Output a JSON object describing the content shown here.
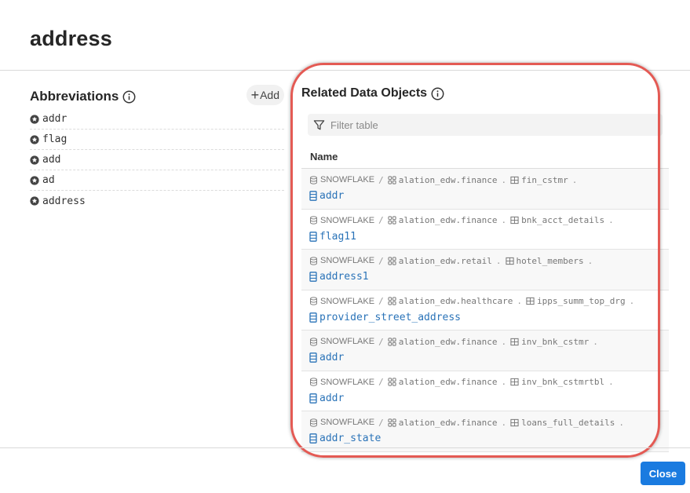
{
  "page": {
    "title": "address"
  },
  "abbreviations": {
    "title": "Abbreviations",
    "add_label": "Add",
    "items": [
      "addr",
      "flag",
      "add",
      "ad",
      "address"
    ]
  },
  "related": {
    "title": "Related Data Objects",
    "filter_placeholder": "Filter table",
    "column_header": "Name",
    "rows": [
      {
        "datasource": "SNOWFLAKE",
        "schema": "alation_edw.finance",
        "table": "fin_cstmr",
        "column": "addr"
      },
      {
        "datasource": "SNOWFLAKE",
        "schema": "alation_edw.finance",
        "table": "bnk_acct_details",
        "column": "flag11"
      },
      {
        "datasource": "SNOWFLAKE",
        "schema": "alation_edw.retail",
        "table": "hotel_members",
        "column": "address1"
      },
      {
        "datasource": "SNOWFLAKE",
        "schema": "alation_edw.healthcare",
        "table": "ipps_summ_top_drg",
        "column": "provider_street_address"
      },
      {
        "datasource": "SNOWFLAKE",
        "schema": "alation_edw.finance",
        "table": "inv_bnk_cstmr",
        "column": "addr"
      },
      {
        "datasource": "SNOWFLAKE",
        "schema": "alation_edw.finance",
        "table": "inv_bnk_cstmrtbl",
        "column": "addr"
      },
      {
        "datasource": "SNOWFLAKE",
        "schema": "alation_edw.finance",
        "table": "loans_full_details",
        "column": "addr_state"
      }
    ],
    "separator_slash": "/",
    "separator_dot": "."
  },
  "footer": {
    "close_label": "Close"
  },
  "colors": {
    "accent": "#1a7be0",
    "link": "#2a73b8",
    "highlight": "#e45a54"
  }
}
